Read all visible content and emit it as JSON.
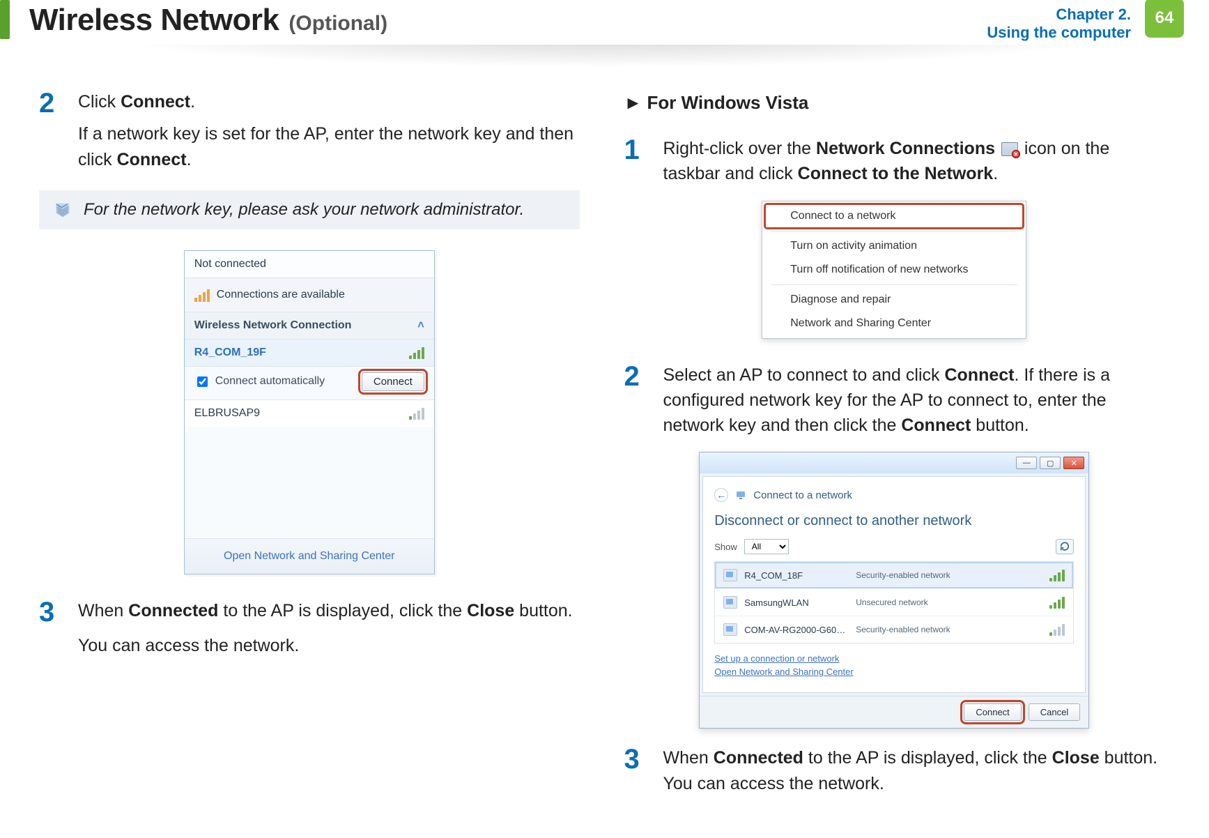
{
  "header": {
    "title": "Wireless Network",
    "subtitle": "(Optional)",
    "chapter_line1": "Chapter 2.",
    "chapter_line2": "Using the computer",
    "page_number": "64"
  },
  "left": {
    "step2_num": "2",
    "step2_line1a": "Click ",
    "step2_line1b": "Connect",
    "step2_line1c": ".",
    "step2_line2a": "If a network key is set for the AP, enter the network key and then click ",
    "step2_line2b": "Connect",
    "step2_line2c": ".",
    "note": "For the network key, please ask your network administrator.",
    "flyout": {
      "not_connected": "Not connected",
      "available": "Connections are available",
      "section": "Wireless Network Connection",
      "ap_selected": "R4_COM_19F",
      "auto_label": "Connect automatically",
      "connect_btn": "Connect",
      "ap_other": "ELBRUSAP9",
      "footer_link": "Open Network and Sharing Center"
    },
    "step3_num": "3",
    "step3_a": "When ",
    "step3_b": "Connected",
    "step3_c": " to the AP is displayed, click the ",
    "step3_d": "Close",
    "step3_e": " button.",
    "step3_line2": "You can access the network."
  },
  "right": {
    "lead": "► For Windows Vista",
    "step1_num": "1",
    "step1_a": "Right-click over the ",
    "step1_b": "Network Connections",
    "step1_c": " icon on the taskbar and click ",
    "step1_d": "Connect to the Network",
    "step1_e": ".",
    "ctx": {
      "i0": "Connect to a network",
      "i1": "Turn on activity animation",
      "i2": "Turn off notification of new networks",
      "i3": "Diagnose and repair",
      "i4": "Network and Sharing Center"
    },
    "step2_num": "2",
    "step2_a": "Select an AP to connect to and click ",
    "step2_b": "Connect",
    "step2_c": ". If there is a configured network key for the AP to connect to, enter the network key and then click the ",
    "step2_d": "Connect",
    "step2_e": " button.",
    "vista": {
      "crumb": "Connect to a network",
      "heading": "Disconnect or connect to another network",
      "show_label": "Show",
      "show_value": "All",
      "nets": [
        {
          "name": "R4_COM_18F",
          "sec": "Security-enabled network",
          "sel": true,
          "strength": 5
        },
        {
          "name": "SamsungWLAN",
          "sec": "Unsecured network",
          "sel": false,
          "strength": 4
        },
        {
          "name": "COM-AV-RG2000-G60…",
          "sec": "Security-enabled network",
          "sel": false,
          "strength": 1
        }
      ],
      "link1": "Set up a connection or network",
      "link2": "Open Network and Sharing Center",
      "connect": "Connect",
      "cancel": "Cancel"
    },
    "step3_num": "3",
    "step3_a": "When ",
    "step3_b": "Connected",
    "step3_c": " to the AP is displayed, click the ",
    "step3_d": "Close",
    "step3_e": " button. You can access the network."
  }
}
